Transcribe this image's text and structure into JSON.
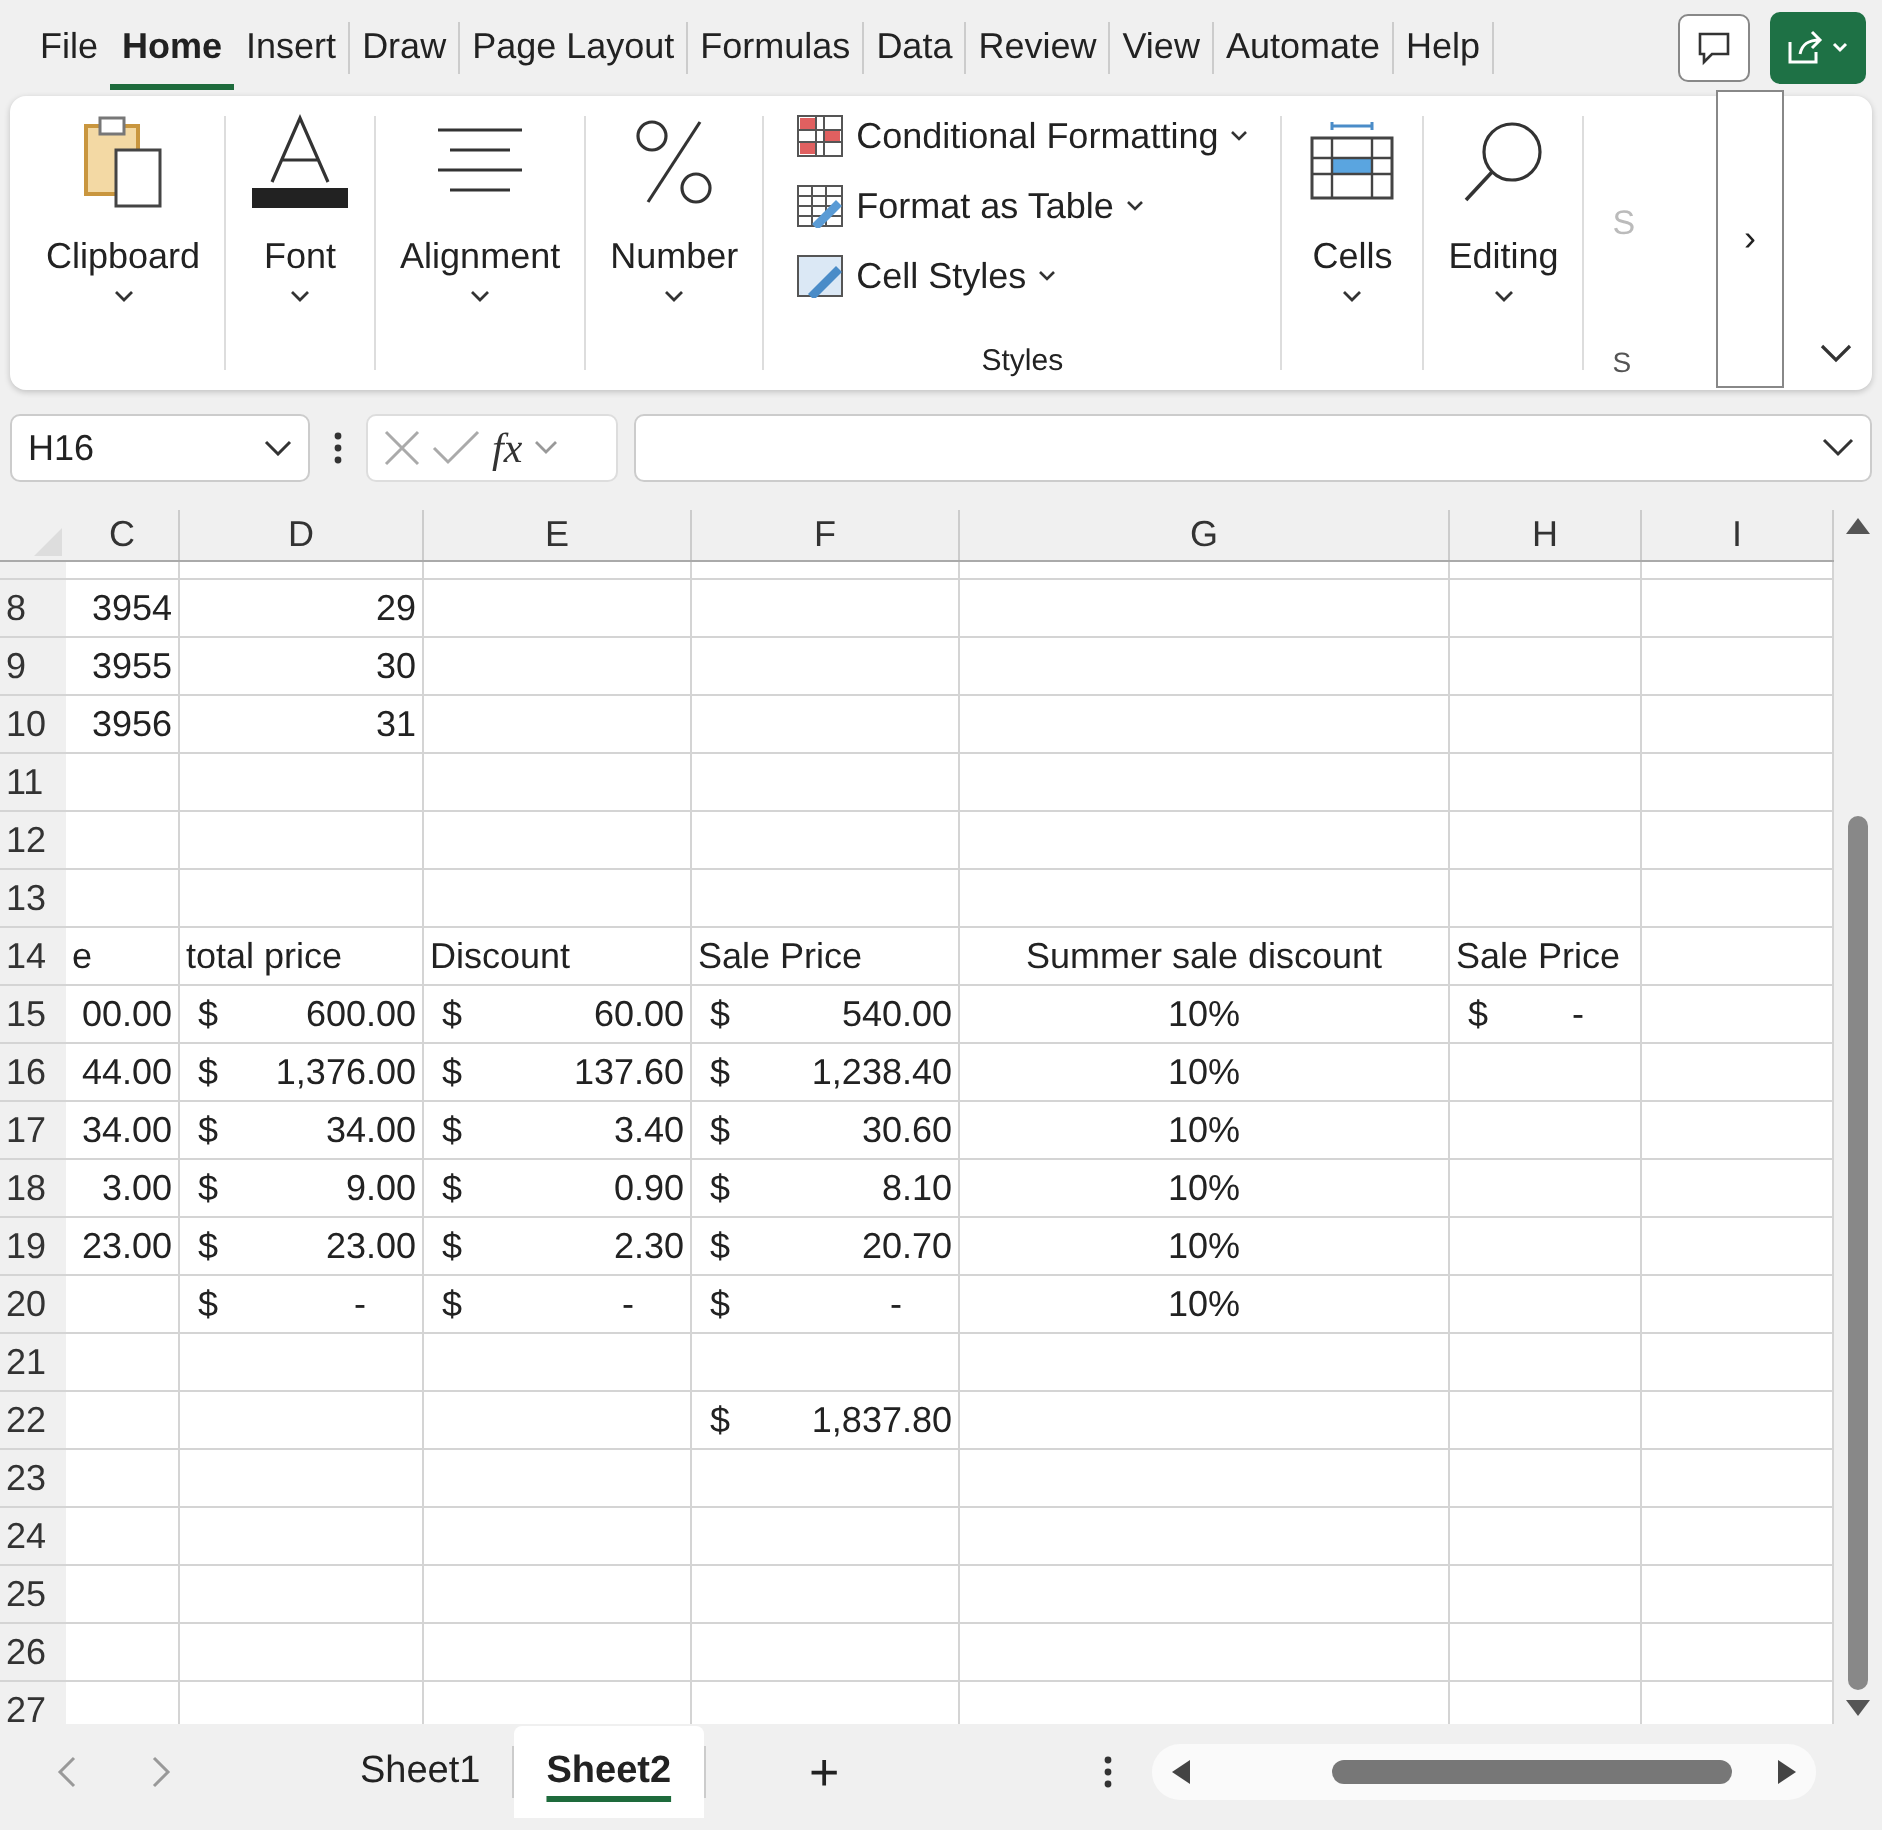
{
  "menu_tabs": [
    {
      "label": "File",
      "selected": false
    },
    {
      "label": "Home",
      "selected": true
    },
    {
      "label": "Insert",
      "selected": false
    },
    {
      "label": "Draw",
      "selected": false
    },
    {
      "label": "Page Layout",
      "selected": false
    },
    {
      "label": "Formulas",
      "selected": false
    },
    {
      "label": "Data",
      "selected": false
    },
    {
      "label": "Review",
      "selected": false
    },
    {
      "label": "View",
      "selected": false
    },
    {
      "label": "Automate",
      "selected": false
    },
    {
      "label": "Help",
      "selected": false
    }
  ],
  "ribbon": {
    "big_groups": [
      {
        "kind": "clipboard",
        "label": "Clipboard"
      },
      {
        "kind": "font",
        "label": "Font"
      },
      {
        "kind": "alignment",
        "label": "Alignment"
      },
      {
        "kind": "number",
        "label": "Number"
      }
    ],
    "styles": {
      "items": [
        {
          "kind": "conditional",
          "label": "Conditional Formatting"
        },
        {
          "kind": "table",
          "label": "Format as Table"
        },
        {
          "kind": "cellstyles",
          "label": "Cell Styles"
        }
      ],
      "label": "Styles"
    },
    "end_groups": [
      {
        "kind": "cells",
        "label": "Cells"
      },
      {
        "kind": "editing",
        "label": "Editing"
      }
    ],
    "cut_group": {
      "label": "S",
      "footer": "S"
    },
    "scroll_button": "›"
  },
  "formula_bar": {
    "name_box": "H16",
    "fx": "fx"
  },
  "columns": [
    {
      "label": "C"
    },
    {
      "label": "D"
    },
    {
      "label": "E"
    },
    {
      "label": "F"
    },
    {
      "label": "G"
    },
    {
      "label": "H"
    },
    {
      "label": "I"
    }
  ],
  "rows": [
    {
      "number": "8",
      "cells": {
        "C": {
          "kind": "number",
          "text": "3954"
        },
        "D": {
          "kind": "number",
          "text": "29"
        }
      }
    },
    {
      "number": "9",
      "cells": {
        "C": {
          "kind": "number",
          "text": "3955"
        },
        "D": {
          "kind": "number",
          "text": "30"
        }
      }
    },
    {
      "number": "10",
      "cells": {
        "C": {
          "kind": "number",
          "text": "3956"
        },
        "D": {
          "kind": "number",
          "text": "31"
        }
      }
    },
    {
      "number": "11",
      "cells": {}
    },
    {
      "number": "12",
      "cells": {}
    },
    {
      "number": "13",
      "cells": {}
    },
    {
      "number": "14",
      "cells": {
        "C": {
          "kind": "text",
          "text": "e"
        },
        "D": {
          "kind": "text",
          "text": "total price"
        },
        "E": {
          "kind": "text",
          "text": "Discount"
        },
        "F": {
          "kind": "text",
          "text": "Sale Price"
        },
        "G": {
          "kind": "center",
          "text": "Summer sale discount"
        },
        "H": {
          "kind": "text",
          "text": "Sale Price"
        }
      }
    },
    {
      "number": "15",
      "cells": {
        "C": {
          "kind": "number",
          "text": "00.00"
        },
        "D": {
          "kind": "currency",
          "symbol": "$",
          "text": "600.00"
        },
        "E": {
          "kind": "currency",
          "symbol": "$",
          "text": "60.00"
        },
        "F": {
          "kind": "currency",
          "symbol": "$",
          "text": "540.00"
        },
        "G": {
          "kind": "center",
          "text": "10%"
        },
        "H": {
          "kind": "currency-zero",
          "symbol": "$",
          "text": "-"
        }
      }
    },
    {
      "number": "16",
      "cells": {
        "C": {
          "kind": "number",
          "text": "44.00"
        },
        "D": {
          "kind": "currency",
          "symbol": "$",
          "text": "1,376.00"
        },
        "E": {
          "kind": "currency",
          "symbol": "$",
          "text": "137.60"
        },
        "F": {
          "kind": "currency",
          "symbol": "$",
          "text": "1,238.40"
        },
        "G": {
          "kind": "center",
          "text": "10%"
        }
      }
    },
    {
      "number": "17",
      "cells": {
        "C": {
          "kind": "number",
          "text": "34.00"
        },
        "D": {
          "kind": "currency",
          "symbol": "$",
          "text": "34.00"
        },
        "E": {
          "kind": "currency",
          "symbol": "$",
          "text": "3.40"
        },
        "F": {
          "kind": "currency",
          "symbol": "$",
          "text": "30.60"
        },
        "G": {
          "kind": "center",
          "text": "10%"
        }
      }
    },
    {
      "number": "18",
      "cells": {
        "C": {
          "kind": "number",
          "text": "3.00"
        },
        "D": {
          "kind": "currency",
          "symbol": "$",
          "text": "9.00"
        },
        "E": {
          "kind": "currency",
          "symbol": "$",
          "text": "0.90"
        },
        "F": {
          "kind": "currency",
          "symbol": "$",
          "text": "8.10"
        },
        "G": {
          "kind": "center",
          "text": "10%"
        }
      }
    },
    {
      "number": "19",
      "cells": {
        "C": {
          "kind": "number",
          "text": "23.00"
        },
        "D": {
          "kind": "currency",
          "symbol": "$",
          "text": "23.00"
        },
        "E": {
          "kind": "currency",
          "symbol": "$",
          "text": "2.30"
        },
        "F": {
          "kind": "currency",
          "symbol": "$",
          "text": "20.70"
        },
        "G": {
          "kind": "center",
          "text": "10%"
        }
      }
    },
    {
      "number": "20",
      "cells": {
        "D": {
          "kind": "currency-zero",
          "symbol": "$",
          "text": "-"
        },
        "E": {
          "kind": "currency-zero",
          "symbol": "$",
          "text": "-"
        },
        "F": {
          "kind": "currency-zero",
          "symbol": "$",
          "text": "-"
        },
        "G": {
          "kind": "center",
          "text": "10%"
        }
      }
    },
    {
      "number": "21",
      "cells": {}
    },
    {
      "number": "22",
      "cells": {
        "F": {
          "kind": "currency",
          "symbol": "$",
          "text": "1,837.80"
        }
      }
    },
    {
      "number": "23",
      "cells": {}
    },
    {
      "number": "24",
      "cells": {}
    },
    {
      "number": "25",
      "cells": {}
    },
    {
      "number": "26",
      "cells": {}
    },
    {
      "number": "27",
      "cells": {}
    }
  ],
  "sheet_tabs": [
    {
      "label": "Sheet1",
      "selected": false
    },
    {
      "label": "Sheet2",
      "selected": true
    }
  ],
  "add_sheet": "+"
}
